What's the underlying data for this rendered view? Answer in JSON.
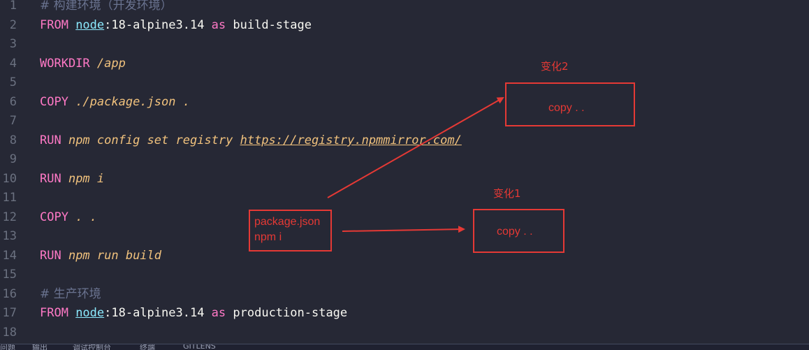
{
  "editor": {
    "lines": [
      {
        "n": "1",
        "parts": [
          {
            "t": "# 构建环境（开发环境）",
            "c": "cmt"
          }
        ]
      },
      {
        "n": "2",
        "parts": [
          {
            "t": "FROM ",
            "c": "kw"
          },
          {
            "t": "node",
            "c": "node"
          },
          {
            "t": ":18-alpine3.14 ",
            "c": "plain"
          },
          {
            "t": "as ",
            "c": "kw"
          },
          {
            "t": "build-stage",
            "c": "plain"
          }
        ]
      },
      {
        "n": "3",
        "parts": []
      },
      {
        "n": "4",
        "parts": [
          {
            "t": "WORKDIR ",
            "c": "kw"
          },
          {
            "t": "/app",
            "c": "str"
          }
        ]
      },
      {
        "n": "5",
        "parts": []
      },
      {
        "n": "6",
        "parts": [
          {
            "t": "COPY ",
            "c": "kw"
          },
          {
            "t": "./package.json .",
            "c": "str"
          }
        ]
      },
      {
        "n": "7",
        "parts": []
      },
      {
        "n": "8",
        "parts": [
          {
            "t": "RUN ",
            "c": "kw"
          },
          {
            "t": "npm config set registry ",
            "c": "str"
          },
          {
            "t": "https://registry.npmmirror.com/",
            "c": "link"
          }
        ]
      },
      {
        "n": "9",
        "parts": []
      },
      {
        "n": "10",
        "parts": [
          {
            "t": "RUN ",
            "c": "kw"
          },
          {
            "t": "npm i",
            "c": "str"
          }
        ]
      },
      {
        "n": "11",
        "parts": []
      },
      {
        "n": "12",
        "parts": [
          {
            "t": "COPY ",
            "c": "kw"
          },
          {
            "t": ". .",
            "c": "str"
          }
        ]
      },
      {
        "n": "13",
        "parts": []
      },
      {
        "n": "14",
        "parts": [
          {
            "t": "RUN ",
            "c": "kw"
          },
          {
            "t": "npm run build",
            "c": "str"
          }
        ]
      },
      {
        "n": "15",
        "parts": []
      },
      {
        "n": "16",
        "parts": [
          {
            "t": "# 生产环境",
            "c": "cmt"
          }
        ]
      },
      {
        "n": "17",
        "parts": [
          {
            "t": "FROM ",
            "c": "kw"
          },
          {
            "t": "node",
            "c": "node"
          },
          {
            "t": ":18-alpine3.14 ",
            "c": "plain"
          },
          {
            "t": "as ",
            "c": "kw"
          },
          {
            "t": "production-stage",
            "c": "plain"
          }
        ]
      },
      {
        "n": "18",
        "parts": []
      }
    ]
  },
  "annotations": {
    "source_box_line1": "package.json",
    "source_box_line2": "npm i",
    "change1_label": "变化1",
    "change1_box": "copy . .",
    "change2_label": "变化2",
    "change2_box": "copy . .",
    "color": "#e53935"
  },
  "status_bar": {
    "items": [
      "问题",
      "输出",
      "调试控制台",
      "终端",
      "GITLENS"
    ]
  }
}
